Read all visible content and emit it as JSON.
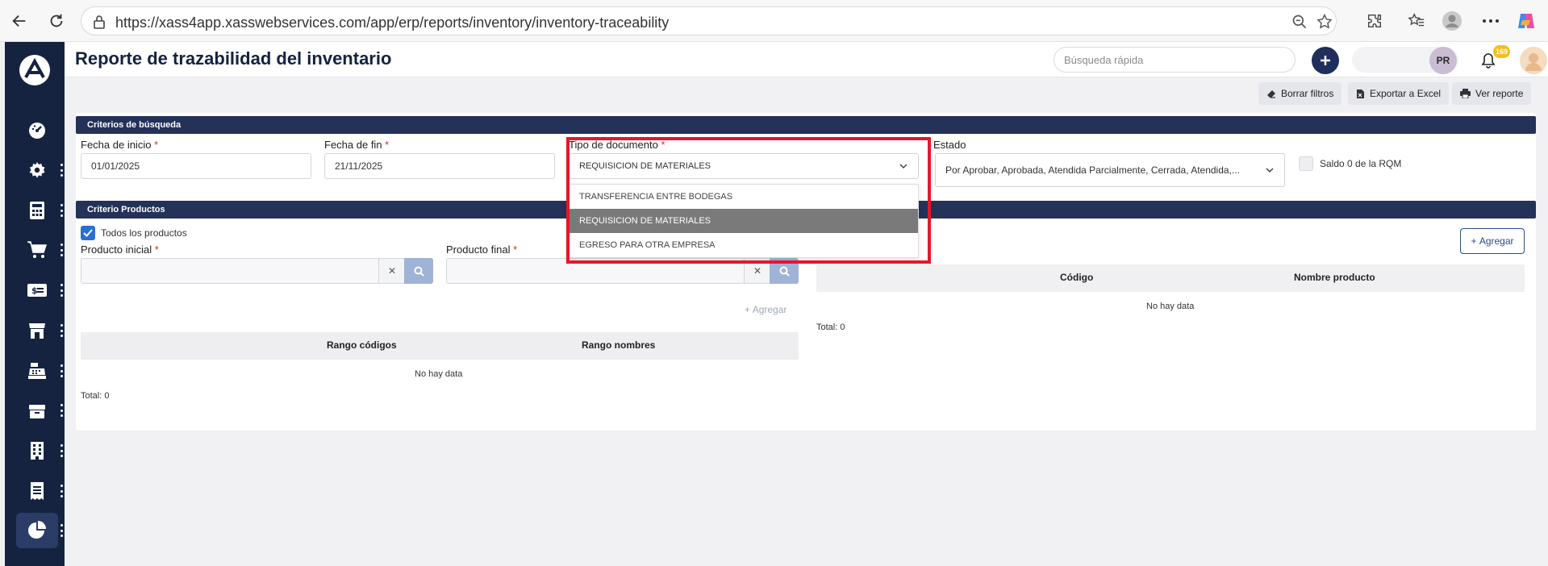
{
  "browser": {
    "url": "https://xass4app.xasswebservices.com/app/erp/reports/inventory/inventory-traceability"
  },
  "header": {
    "title": "Reporte de trazabilidad del inventario",
    "quick_search_placeholder": "Búsqueda rápida",
    "avatar_initials": "PR",
    "notification_count": "169"
  },
  "actions": {
    "clear_filters": "Borrar filtros",
    "export_excel": "Exportar a Excel",
    "view_report": "Ver reporte"
  },
  "search_criteria": {
    "section_title": "Criterios de búsqueda",
    "start_date_label": "Fecha de inicio",
    "start_date_value": "01/01/2025",
    "end_date_label": "Fecha de fin",
    "end_date_value": "21/11/2025",
    "doc_type_label": "Tipo de documento",
    "doc_type_value": "REQUISICION DE MATERIALES",
    "doc_type_options": [
      "TRANSFERENCIA ENTRE BODEGAS",
      "REQUISICION DE MATERIALES",
      "EGRESO PARA OTRA EMPRESA"
    ],
    "status_label": "Estado",
    "status_value": "Por Aprobar, Aprobada, Atendida Parcialmente, Cerrada, Atendida,...",
    "saldo_label": "Saldo 0 de la RQM"
  },
  "products": {
    "section_title": "Criterio Productos",
    "all_products_label": "Todos los productos",
    "initial_product_label": "Producto inicial",
    "final_product_label": "Producto final",
    "add_link": "Agregar",
    "add_button": "Agregar",
    "range_table": {
      "col_codes": "Rango códigos",
      "col_names": "Rango nombres",
      "empty": "No hay data",
      "total": "Total: 0"
    },
    "products_table": {
      "col_code": "Código",
      "col_name": "Nombre producto",
      "empty": "No hay data",
      "total": "Total: 0"
    }
  }
}
